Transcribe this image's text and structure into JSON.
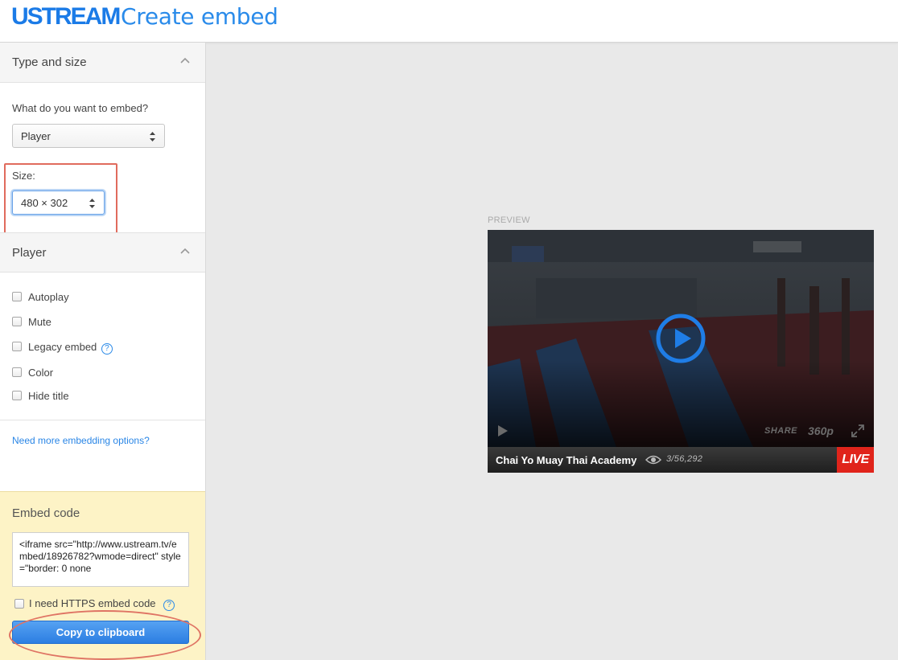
{
  "header": {
    "logo": "USTREAM",
    "title": "Create embed"
  },
  "type_and_size": {
    "title": "Type and size",
    "question": "What do you want to embed?",
    "type_value": "Player",
    "size_label": "Size:",
    "size_value": "480 × 302"
  },
  "player_options": {
    "title": "Player",
    "options": [
      {
        "label": "Autoplay",
        "checked": false
      },
      {
        "label": "Mute",
        "checked": false
      },
      {
        "label": "Legacy embed",
        "checked": false,
        "help": "?"
      },
      {
        "label": "Color",
        "checked": false
      },
      {
        "label": "Hide title",
        "checked": false
      }
    ],
    "more_link": "Need more embedding options?"
  },
  "embed": {
    "title": "Embed code",
    "code": "<iframe src=\"http://www.ustream.tv/embed/18926782?wmode=direct\" style=\"border: 0 none",
    "https_label": "I need HTTPS embed code",
    "https_help": "?",
    "copy_label": "Copy to clipboard"
  },
  "preview": {
    "label": "PREVIEW",
    "share": "SHARE",
    "quality": "360p",
    "channel": "Chai Yo Muay Thai Academy",
    "viewers": "3/56,292",
    "live": "LIVE"
  },
  "colors": {
    "brand": "#1b7be7",
    "live": "#e0241b",
    "highlight": "#e06b5d",
    "embed_bg": "#fdf3c6"
  }
}
